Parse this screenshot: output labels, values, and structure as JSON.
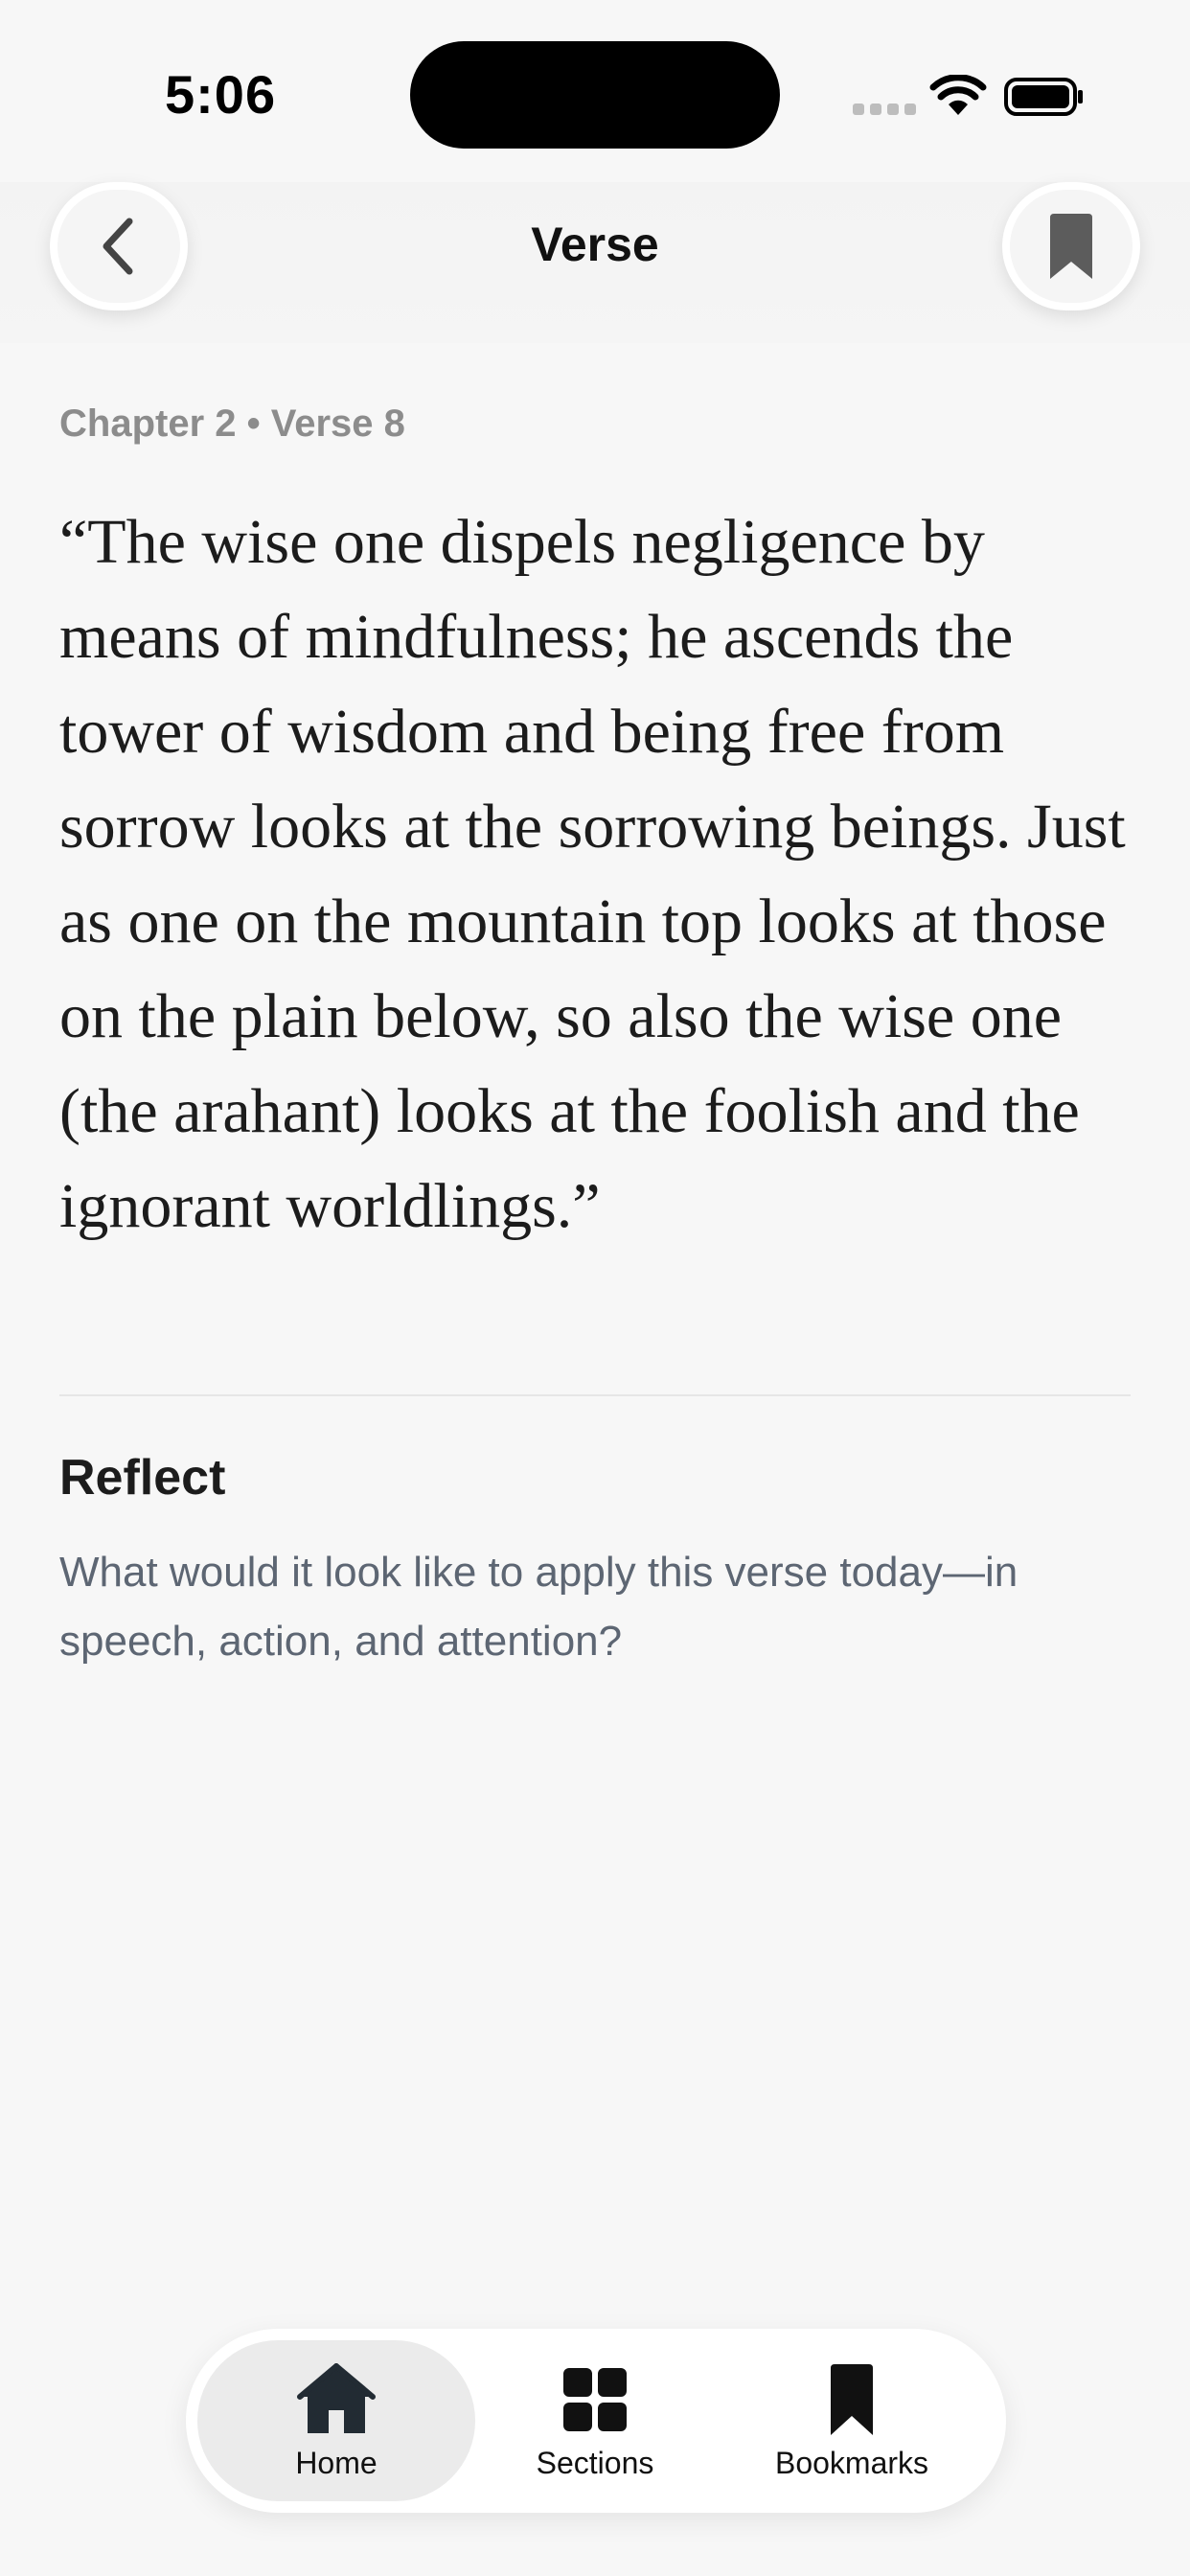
{
  "status_bar": {
    "time": "5:06"
  },
  "nav": {
    "title": "Verse",
    "back_icon": "chevron-left-icon",
    "bookmark_icon": "bookmark-icon"
  },
  "verse": {
    "reference": "Chapter 2 • Verse 8",
    "text": "“The wise one dispels negligence by means of mindfulness; he ascends the tower of wisdom and being free from sorrow looks at the sorrowing beings. Just as one on the mountain top looks at those on the plain below, so also the wise one (the arahant) looks at the foolish and the ignorant worldlings.”"
  },
  "reflect": {
    "title": "Reflect",
    "text": "What would it look like to apply this verse today—in speech, action, and attention?"
  },
  "tab_bar": {
    "items": [
      {
        "label": "Home",
        "icon": "home-icon",
        "active": true
      },
      {
        "label": "Sections",
        "icon": "grid-icon",
        "active": false
      },
      {
        "label": "Bookmarks",
        "icon": "bookmark-icon",
        "active": false
      }
    ]
  },
  "colors": {
    "background": "#f7f7f7",
    "verse_ref": "#8c8c8c",
    "reflect_text": "#5d6673",
    "active_tab_bg": "#ebebeb",
    "icon_dark": "#222b33",
    "bookmark_gray": "#5c5c5c"
  }
}
